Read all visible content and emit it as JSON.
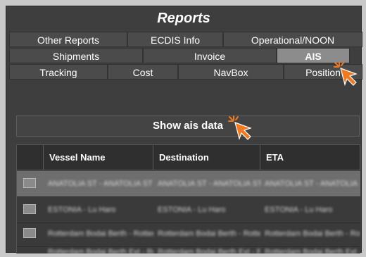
{
  "panel": {
    "title": "Reports"
  },
  "tabs": {
    "row1": [
      {
        "label": "Other Reports"
      },
      {
        "label": "ECDIS Info"
      },
      {
        "label": "Operational/NOON"
      }
    ],
    "row2": [
      {
        "label": "Shipments"
      },
      {
        "label": "Invoice"
      },
      {
        "label": "AIS",
        "active": true
      }
    ],
    "row3": [
      {
        "label": "Tracking"
      },
      {
        "label": "Cost"
      },
      {
        "label": "NavBox"
      },
      {
        "label": "Position"
      }
    ]
  },
  "show_button": {
    "label": "Show ais data"
  },
  "grid": {
    "columns": [
      "",
      "Vessel Name",
      "Destination",
      "ETA"
    ],
    "rows": [
      {
        "selected": true,
        "cells": [
          "ANATOLIA ST - ANATOLIA ST",
          "ANATOLIA ST - ANATOLIA ST",
          "ANATOLIA ST - ANATOLIA ST"
        ]
      },
      {
        "selected": false,
        "cells": [
          "ESTONIA - Lu Haro",
          "ESTONIA - Lu Haro",
          "ESTONIA - Lu Haro"
        ]
      },
      {
        "selected": false,
        "cells": [
          "Rotterdam Bodai Berth - Rotterdam Bo",
          "Rotterdam Bodai Berth - Rotterdam Bo",
          "Rotterdam Bodai Berth - Rotterdam Bo"
        ]
      },
      {
        "selected": false,
        "cells": [
          "Rotterdam Bodai Berth Ext - Rotterdam",
          "Rotterdam Bodai Berth Ext - Rotterdam",
          "Rotterdam Bodai Berth Ext - Rotterdam"
        ]
      }
    ]
  },
  "colors": {
    "cursor_arrow": "#ef7a22",
    "active_tab": "#8c8c8c"
  },
  "icons": {
    "cursor": "click-cursor-icon"
  }
}
